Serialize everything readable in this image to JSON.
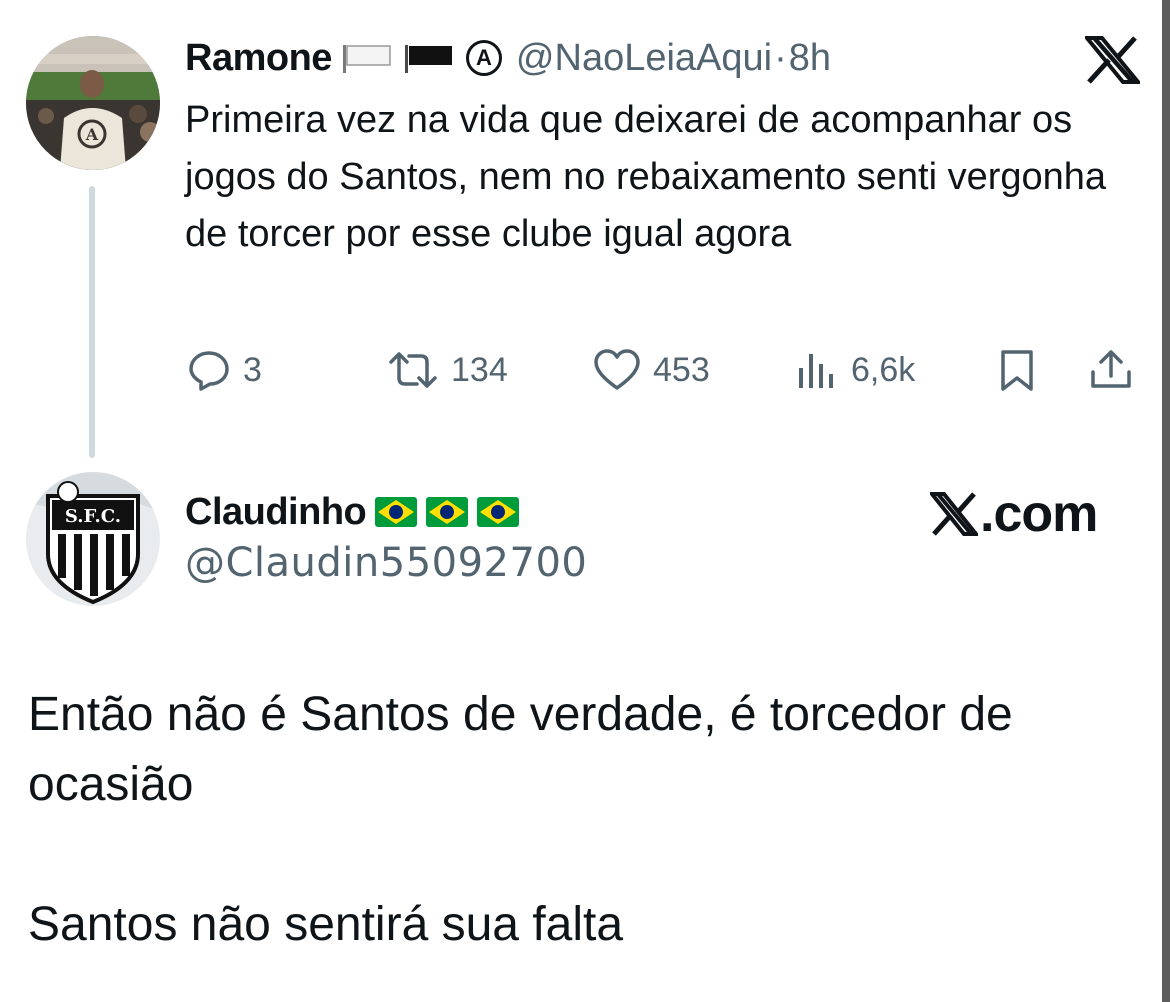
{
  "tweet": {
    "author_name": "Ramone",
    "handle": "@NaoLeiaAqui",
    "separator": "·",
    "time": "8h",
    "text": "Primeira vez na vida que deixarei de acompanhar os jogos do Santos, nem no rebaixamento senti vergonha de torcer por esse clube igual agora",
    "badges": [
      "white-flag-icon",
      "black-flag-icon",
      "anarchy-symbol-icon"
    ],
    "badge_glyph": "A",
    "actions": {
      "replies": "3",
      "retweets": "134",
      "likes": "453",
      "views": "6,6k"
    }
  },
  "reply": {
    "author_name": "Claudinho",
    "badges": [
      "brazil-flag-icon",
      "brazil-flag-icon",
      "brazil-flag-icon"
    ],
    "handle": "@Claudin55092700",
    "brand": ".com",
    "line1": "Então não é Santos de verdade, é torcedor de ocasião",
    "line2": "Santos não sentirá sua falta"
  },
  "colors": {
    "text": "#0f1419",
    "secondary": "#536471",
    "thread_line": "#cfd9de",
    "brazil_green": "#009c3b",
    "brazil_yellow": "#ffdf00",
    "brazil_blue": "#002776"
  }
}
